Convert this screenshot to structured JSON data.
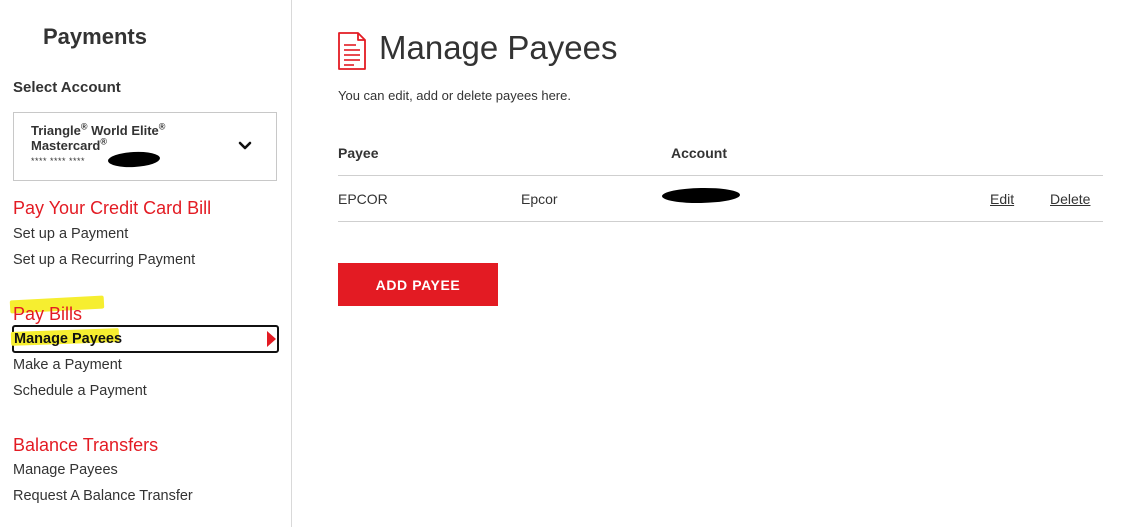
{
  "sidebar": {
    "title": "Payments",
    "select_account_label": "Select Account",
    "account": {
      "name_line1": "Triangle",
      "name_line1b": "World Elite",
      "name_line2": "Mastercard",
      "reg_mark": "®",
      "masked_number": "**** **** ****"
    },
    "sections": [
      {
        "heading": "Pay Your Credit Card Bill",
        "links": [
          "Set up a Payment",
          "Set up a Recurring Payment"
        ]
      },
      {
        "heading": "Pay Bills",
        "links": [
          "Manage Payees",
          "Make a Payment",
          "Schedule a Payment"
        ]
      },
      {
        "heading": "Balance Transfers",
        "links": [
          "Manage Payees",
          "Request A Balance Transfer"
        ]
      }
    ],
    "active_item": "Manage Payees"
  },
  "main": {
    "title": "Manage Payees",
    "subtitle": "You can edit, add or delete payees here.",
    "table": {
      "headers": [
        "Payee",
        "Account"
      ],
      "rows": [
        {
          "payee": "EPCOR",
          "nickname": "Epcor",
          "edit_label": "Edit",
          "delete_label": "Delete"
        }
      ]
    },
    "add_button_label": "ADD PAYEE"
  },
  "colors": {
    "accent": "#e31b23",
    "highlight": "#f6ee30",
    "text": "#333333"
  },
  "icons": [
    "chevron-down-icon",
    "document-icon"
  ]
}
